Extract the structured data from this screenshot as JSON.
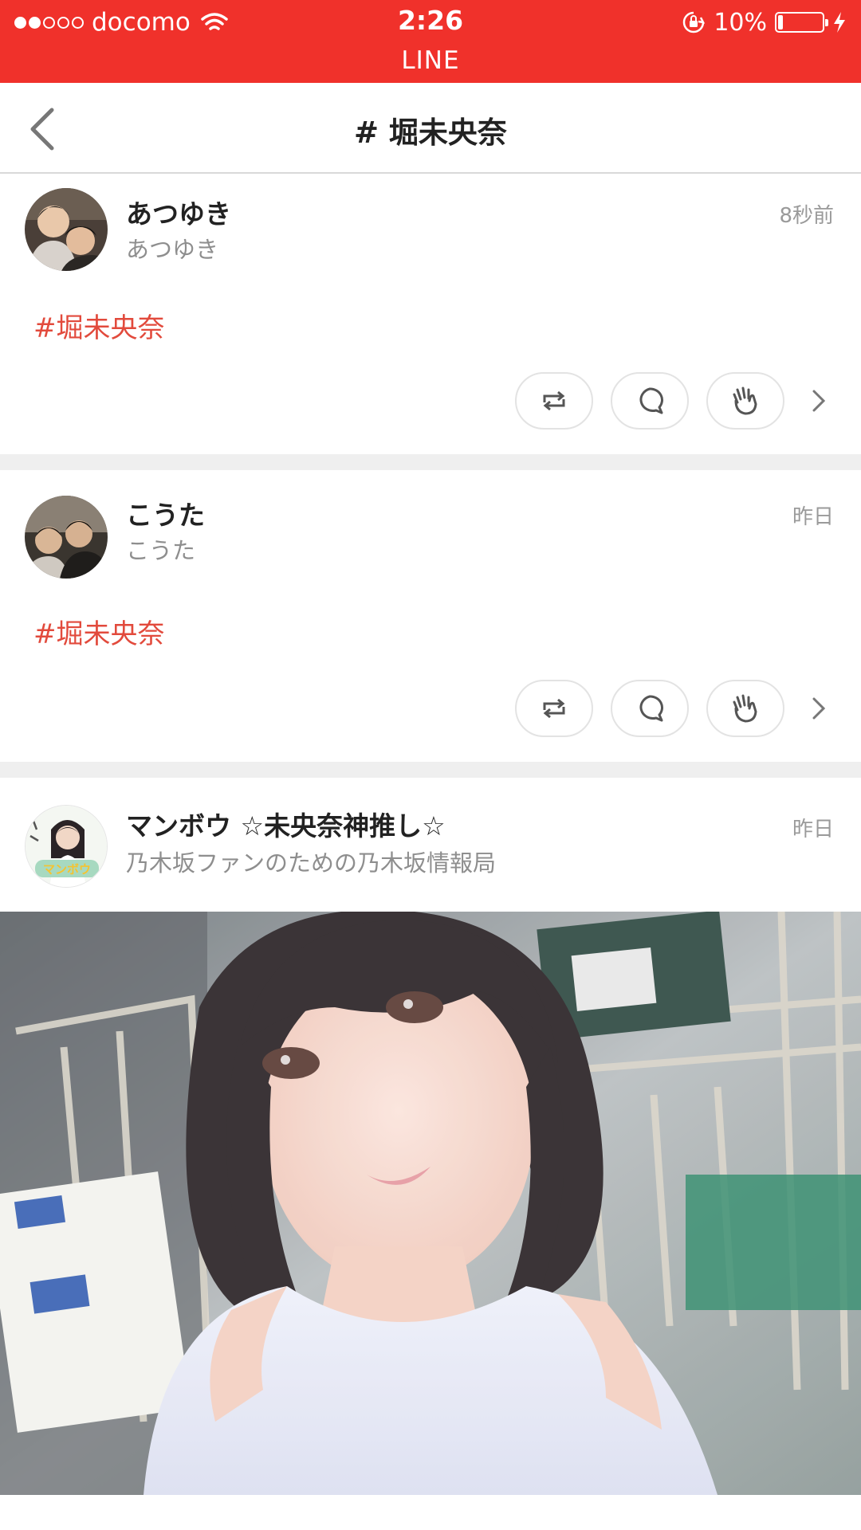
{
  "status_bar": {
    "carrier": "docomo",
    "time": "2:26",
    "battery": "10%",
    "battery_level": 0.1,
    "app_label": "LINE",
    "background_color": "#f0312b"
  },
  "nav": {
    "title": "# 堀未央奈",
    "back_icon": "chevron-left-icon"
  },
  "posts": [
    {
      "name": "あつゆき",
      "sub": "あつゆき",
      "time": "8秒前",
      "hashtag": "#堀未央奈"
    },
    {
      "name": "こうた",
      "sub": "こうた",
      "time": "昨日",
      "hashtag": "#堀未央奈"
    },
    {
      "name": "マンボウ ☆未央奈神推し☆",
      "sub": "乃木坂ファンのための乃木坂情報局",
      "time": "昨日",
      "avatar_text": "マンボウ"
    }
  ],
  "action_icons": [
    "share-icon",
    "comment-icon",
    "clap-icon",
    "chevron-right-icon"
  ],
  "colors": {
    "accent": "#f0312b",
    "hashtag": "#e24a3c",
    "divider": "#efefef"
  }
}
